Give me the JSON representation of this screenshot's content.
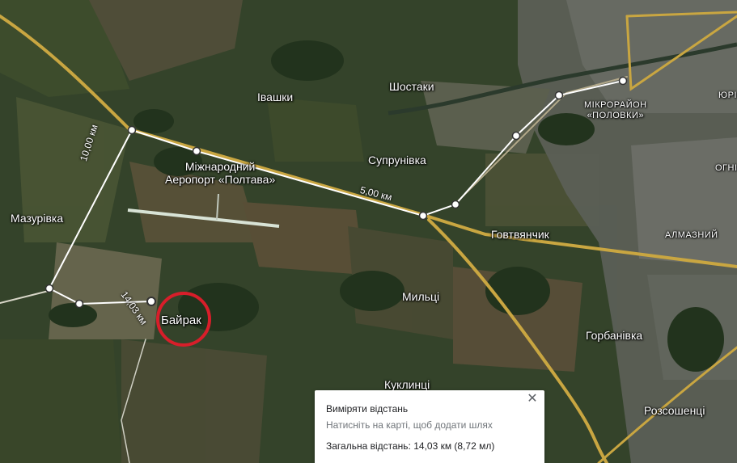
{
  "places": {
    "ivashky": "Івашки",
    "shostaky": "Шостаки",
    "mikroraion": "МІКРОРАЙОН\n«ПОЛОВКИ»",
    "yuri": "ЮРІ",
    "airport": "Міжнародний\nАеропорт «Полтава»",
    "suprunivka": "Супрунівка",
    "ohni": "ОГНІ",
    "mazurivka": "Мазурівка",
    "hovtvianchyk": "Говтвянчик",
    "almaznyi": "АЛМАЗНИЙ",
    "myltsi": "Мильці",
    "bairak": "Байрак",
    "horbanivka": "Горбанівка",
    "kuklyntsi": "Куклинці",
    "rozsoshentsi": "Розсошенці"
  },
  "measure": {
    "segment_labels": {
      "d10": "10,00 км",
      "d5": "5,00 км",
      "d1403": "14,03 км"
    },
    "line_color": "#ffffff",
    "highlight_color": "#d81e2a"
  },
  "panel": {
    "title": "Виміряти відстань",
    "hint": "Натисніть на карті, щоб додати шлях",
    "total": "Загальна відстань: 14,03 км (8,72 мл)",
    "close_icon": "close-icon"
  }
}
